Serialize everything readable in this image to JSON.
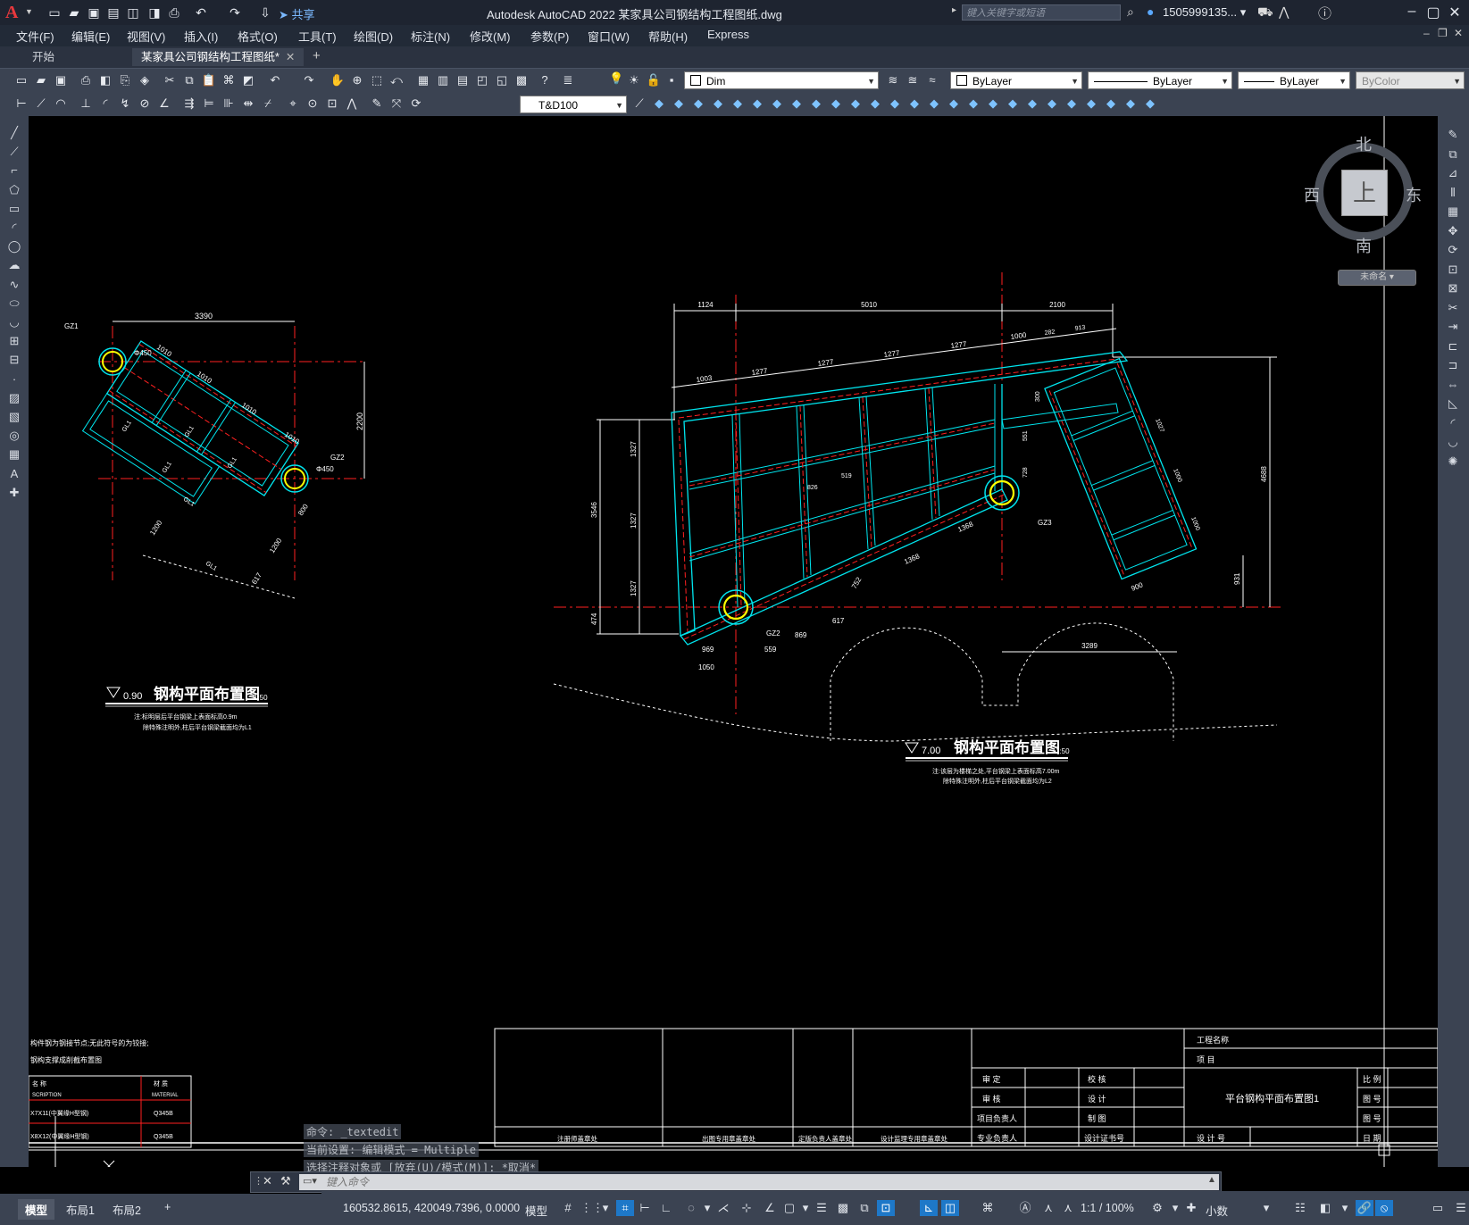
{
  "titlebar": {
    "title": "Autodesk AutoCAD 2022    某家具公司钢结构工程图纸.dwg",
    "share": "共享",
    "search_placeholder": "键入关键字或短语",
    "user": "1505999135... ▾"
  },
  "menu": [
    "文件(F)",
    "编辑(E)",
    "视图(V)",
    "插入(I)",
    "格式(O)",
    "工具(T)",
    "绘图(D)",
    "标注(N)",
    "修改(M)",
    "参数(P)",
    "窗口(W)",
    "帮助(H)",
    "Express"
  ],
  "tabs": {
    "start": "开始",
    "document": "某家具公司钢结构工程图纸*",
    "close": "✕",
    "add": "+"
  },
  "toolbar": {
    "layer": "Dim",
    "color": "ByLayer",
    "linetype": "ByLayer",
    "lineweight": "ByLayer",
    "plotstyle": "ByColor",
    "textstyle": "T&D100"
  },
  "viewcube": {
    "north": "北",
    "south": "南",
    "east": "东",
    "west": "西",
    "top": "上",
    "wcs": "未命名 ▾"
  },
  "drawing": {
    "left_title": "钢构平面布置图",
    "left_scale": "1:50",
    "left_level": "0.90",
    "left_note1": "注:标明层后平台钢梁上表面标高0.9m",
    "left_note2": "除特殊注明外,柱后平台钢梁截面均为L1",
    "right_title": "钢构平面布置图",
    "right_scale": "1:50",
    "right_level": "7.00",
    "right_note1": "注:该层为楼梯之处,平台钢梁上表面标高7.00m",
    "right_note2": "除特殊注明外,柱后平台钢梁截面均为L2",
    "dims_left": [
      "3390",
      "2200",
      "1010",
      "1010",
      "1010",
      "1010",
      "617",
      "800",
      "1200",
      "1200"
    ],
    "dims_right_top": [
      "1124",
      "5010",
      "2100"
    ],
    "dims_right_second": [
      "1003",
      "1277",
      "1277",
      "1277",
      "1277",
      "1000",
      "282",
      "913"
    ],
    "dims_right_left": [
      "1327",
      "1327",
      "1327",
      "3546",
      "474"
    ],
    "dims_right_misc": [
      "4688",
      "1000",
      "1000",
      "1027",
      "931",
      "900",
      "3289",
      "1368",
      "1368",
      "752",
      "617",
      "869",
      "559",
      "1050",
      "969",
      "826",
      "519",
      "300",
      "551",
      "728",
      "757"
    ],
    "col_labels": [
      "GZ1",
      "GZ2",
      "GZ2",
      "GZ3"
    ],
    "beam_labels": [
      "GL1",
      "GL1",
      "GL1",
      "GL1",
      "GL1",
      "GL1",
      "GL1",
      "GL1"
    ],
    "col_size": "Φ450"
  },
  "titleblock": {
    "project_name": "工程名称",
    "item": "项 目",
    "review": "审 定",
    "audit": "审 核",
    "lead": "项目负责人",
    "prof": "专业负责人",
    "check": "校 核",
    "design": "设 计",
    "draw": "制 图",
    "cert": "设计证书号",
    "drawing_name": "平台钢构平面布置图1",
    "design_no": "设 计 号",
    "scale": "比 例",
    "fig_no": "图 号",
    "fig_no2": "图 号",
    "date": "日 期",
    "stamp1": "注册师盖章处",
    "stamp2": "出图专用章盖章处",
    "stamp3": "定版负责人盖章处",
    "stamp4": "设计监理专用章盖章处"
  },
  "left_table": {
    "note1": "构件钢为钢接节点;无此符号的为铰接;",
    "note2": "钢构支撑成削截布置图",
    "header_name": "名  称",
    "header_desc": "SCRIPTION",
    "header_mat": "材 质",
    "header_mat_en": "MATERIAL",
    "row1_name": "X7X11(中翼缘H型钢)",
    "row1_mat": "Q345B",
    "row2_name": "X8X12(中翼缘H型钢)",
    "row2_mat": "Q345B"
  },
  "command": {
    "hist1": "命令: _textedit",
    "hist2": "当前设置: 编辑模式 = Multiple",
    "hist3": "选择注释对象或 [放弃(U)/模式(M)]: *取消*",
    "placeholder": "键入命令"
  },
  "layout_tabs": [
    "模型",
    "布局1",
    "布局2",
    "+"
  ],
  "status": {
    "coords": "160532.8615, 420049.7396, 0.0000",
    "model": "模型",
    "scale": "1:1 / 100%",
    "units": "小数"
  },
  "colors": {
    "accent": "#0d8dd8",
    "bg": "#000000",
    "beam": "#00e5ee",
    "axis": "#ff2020",
    "column": "#ffff00"
  }
}
